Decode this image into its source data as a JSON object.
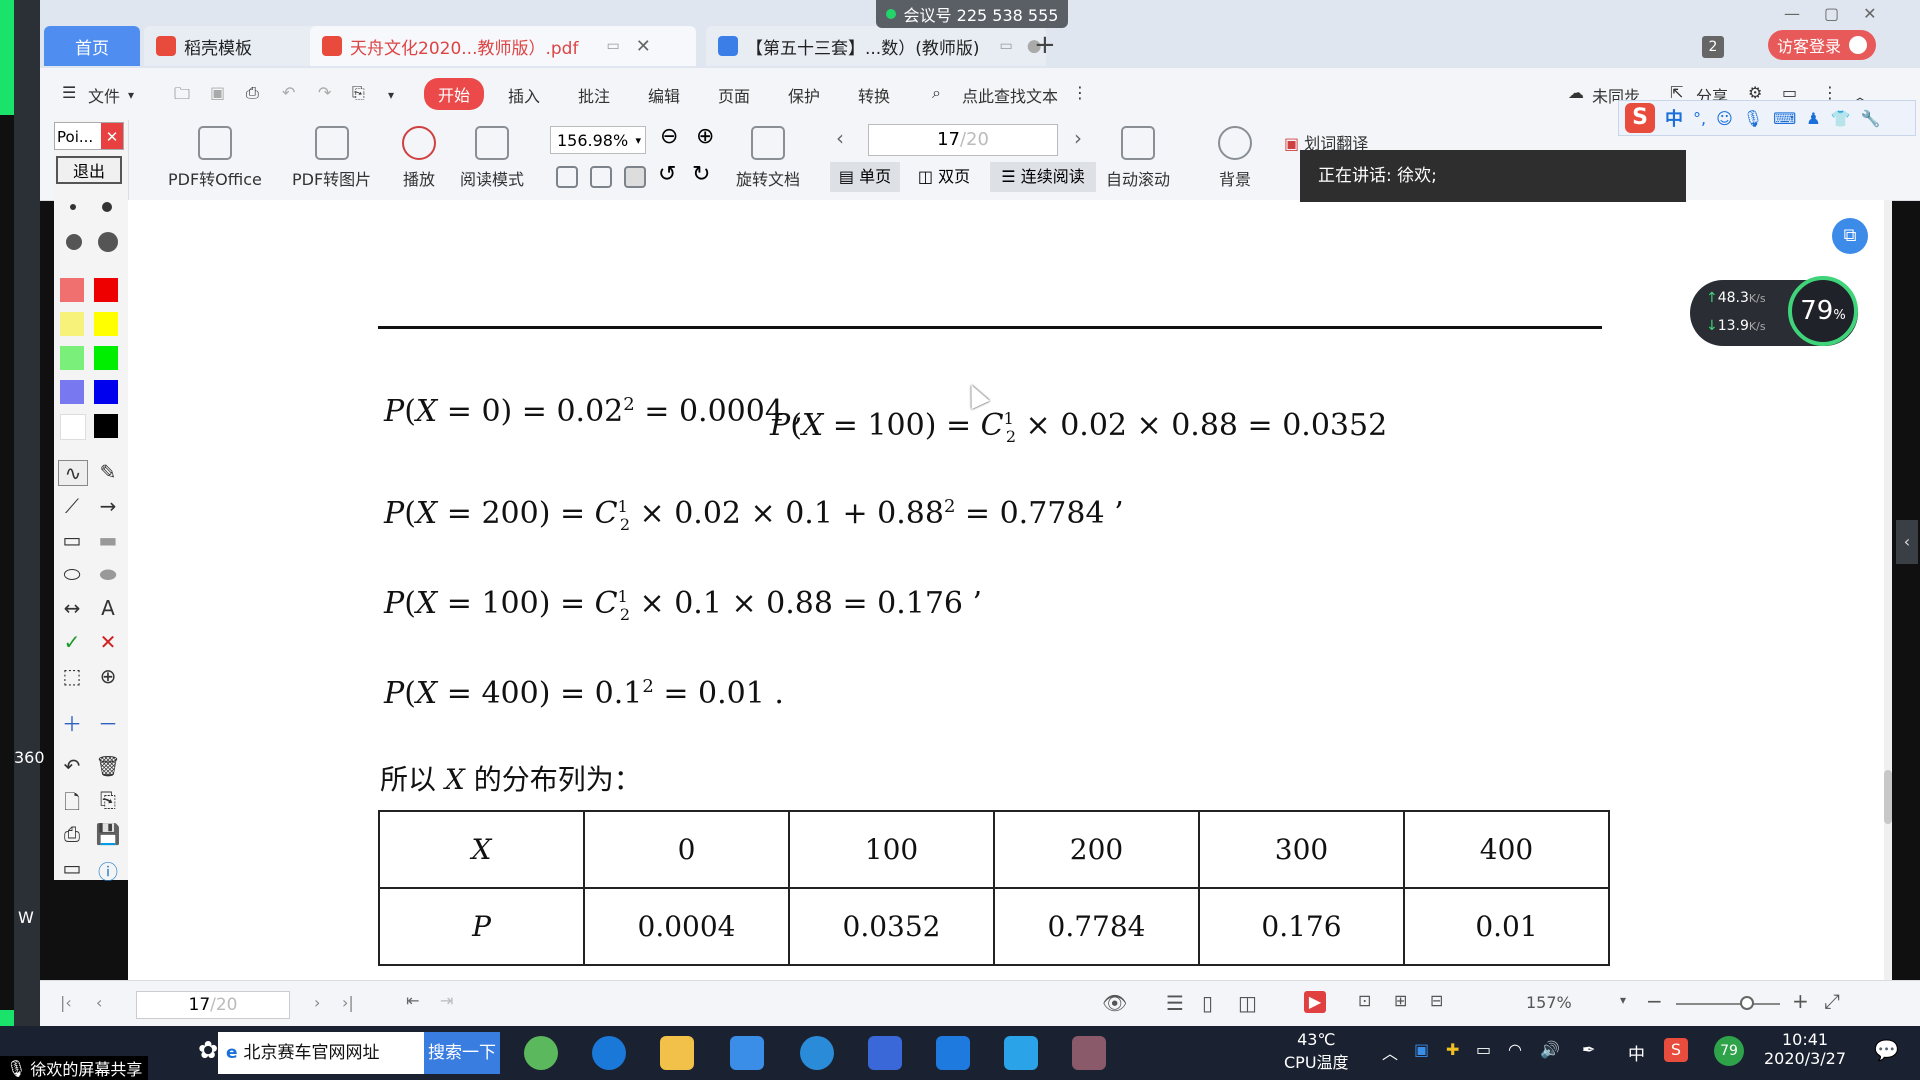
{
  "meeting_id": "会议号 225 538 555",
  "tabs": [
    {
      "label": "首页",
      "active": true
    },
    {
      "label": "稻壳模板"
    },
    {
      "label": "天舟文化2020...教师版）.pdf"
    },
    {
      "label": "【第五十三套】...数）(教师版)"
    }
  ],
  "tab_add": "+",
  "tab_count_badge": "2",
  "visitor_login": "访客登录",
  "menu": {
    "file": "文件",
    "start": "开始",
    "insert": "插入",
    "annotate": "批注",
    "edit": "编辑",
    "page": "页面",
    "protect": "保护",
    "convert": "转换",
    "find": "点此查找文本",
    "unsynced": "未同步",
    "share": "分享"
  },
  "ribbon": {
    "pdf_to_office": "PDF转Office",
    "pdf_to_image": "PDF转图片",
    "play": "播放",
    "read_mode": "阅读模式",
    "zoom": "156.98%",
    "rotate": "旋转文档",
    "page_current": "17",
    "page_total": "/20",
    "single": "单页",
    "double": "双页",
    "continuous": "连续阅读",
    "auto_scroll": "自动滚动",
    "background": "背景",
    "translate": "划词翻译"
  },
  "speaking": "正在讲话: 徐欢;",
  "pen_panel": {
    "title": "Poi...",
    "exit": "退出"
  },
  "ime": {
    "lang": "中"
  },
  "net": {
    "up": "48.3",
    "down": "13.9",
    "unit": "K/s",
    "percent": "79",
    "pct_sign": "%"
  },
  "doc": {
    "prefix_so": "所以",
    "var_x": "X",
    "suffix_dist": "的分布列为："
  },
  "table": {
    "header": [
      "X",
      "0",
      "100",
      "200",
      "300",
      "400"
    ],
    "row": [
      "P",
      "0.0004",
      "0.0352",
      "0.7784",
      "0.176",
      "0.01"
    ]
  },
  "status": {
    "page_current": "17",
    "page_total": "/20",
    "zoom": "157%"
  },
  "taskbar": {
    "screen_share": "徐欢的屏幕共享",
    "search_placeholder": "北京赛车官网网址",
    "search_btn": "搜索一下",
    "temp": "43℃",
    "cpu_label": "CPU温度",
    "ime": "中",
    "time": "10:41",
    "date": "2020/3/27",
    "badge": "79"
  },
  "desktop_bits": {
    "left_360": "360",
    "left_w": "W"
  }
}
